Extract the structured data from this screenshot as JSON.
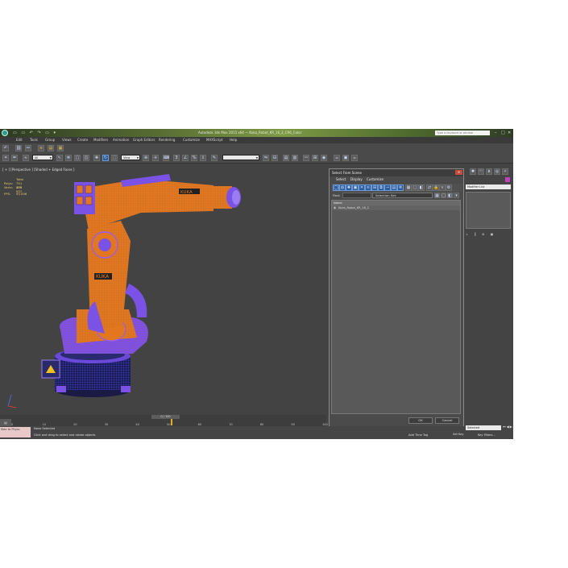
{
  "app": {
    "title": "Autodesk 3ds Max 2015 x64 — Kuka_Robot_KR_16_2_CR6_Color",
    "search_placeholder": "Type a keyword or phrase",
    "window_controls": [
      "–",
      "□",
      "✕"
    ]
  },
  "menubar": [
    "Edit",
    "Tools",
    "Group",
    "Views",
    "Create",
    "Modifiers",
    "Animation",
    "Graph Editors",
    "Rendering",
    "Customize",
    "MAXScript",
    "Help"
  ],
  "toolbar": {
    "selection_filter": "All",
    "coord_system": "View",
    "named_selection": ""
  },
  "viewport": {
    "label": "[ + ] [Perspective ] [Shaded + Edged Faces ]",
    "stats": {
      "total_label": "Total",
      "polys_label": "Polys:",
      "polys_value": "751 400",
      "verts_label": "Verts:",
      "verts_value": "379 937",
      "fps_label": "FPS:",
      "fps_value": "93.006"
    }
  },
  "dialog": {
    "title": "Select From Scene",
    "menu": [
      "Select",
      "Display",
      "Customize"
    ],
    "find_label": "Find:",
    "selection_set_label": "Selection Set:",
    "column_header": "Name",
    "items": [
      "Kuka_Robot_KR_16_2"
    ],
    "ok_label": "OK",
    "cancel_label": "Cancel",
    "close_icon": "close-icon"
  },
  "command_panel": {
    "modifier_list": "Modifier List"
  },
  "timeline": {
    "frame_display": "0 / 100",
    "ticks": [
      "0",
      "5",
      "10",
      "15",
      "20",
      "25",
      "30",
      "35",
      "40",
      "45",
      "50",
      "55",
      "60",
      "65",
      "70",
      "75",
      "80",
      "85",
      "90",
      "95",
      "100"
    ]
  },
  "status": {
    "maxscript_label": "Max to Physc",
    "selection_status": "None Selected",
    "prompt": "Click and drag to select and rotate objects",
    "add_time_tag": "Add Time Tag",
    "set_key": "Set Key",
    "key_filters": "Key Filters...",
    "selected_dd": "Selected"
  },
  "colors": {
    "robot_orange": "#e2771f",
    "wire_purple": "#8a4df0",
    "stats_yellow": "#e8d06a"
  }
}
